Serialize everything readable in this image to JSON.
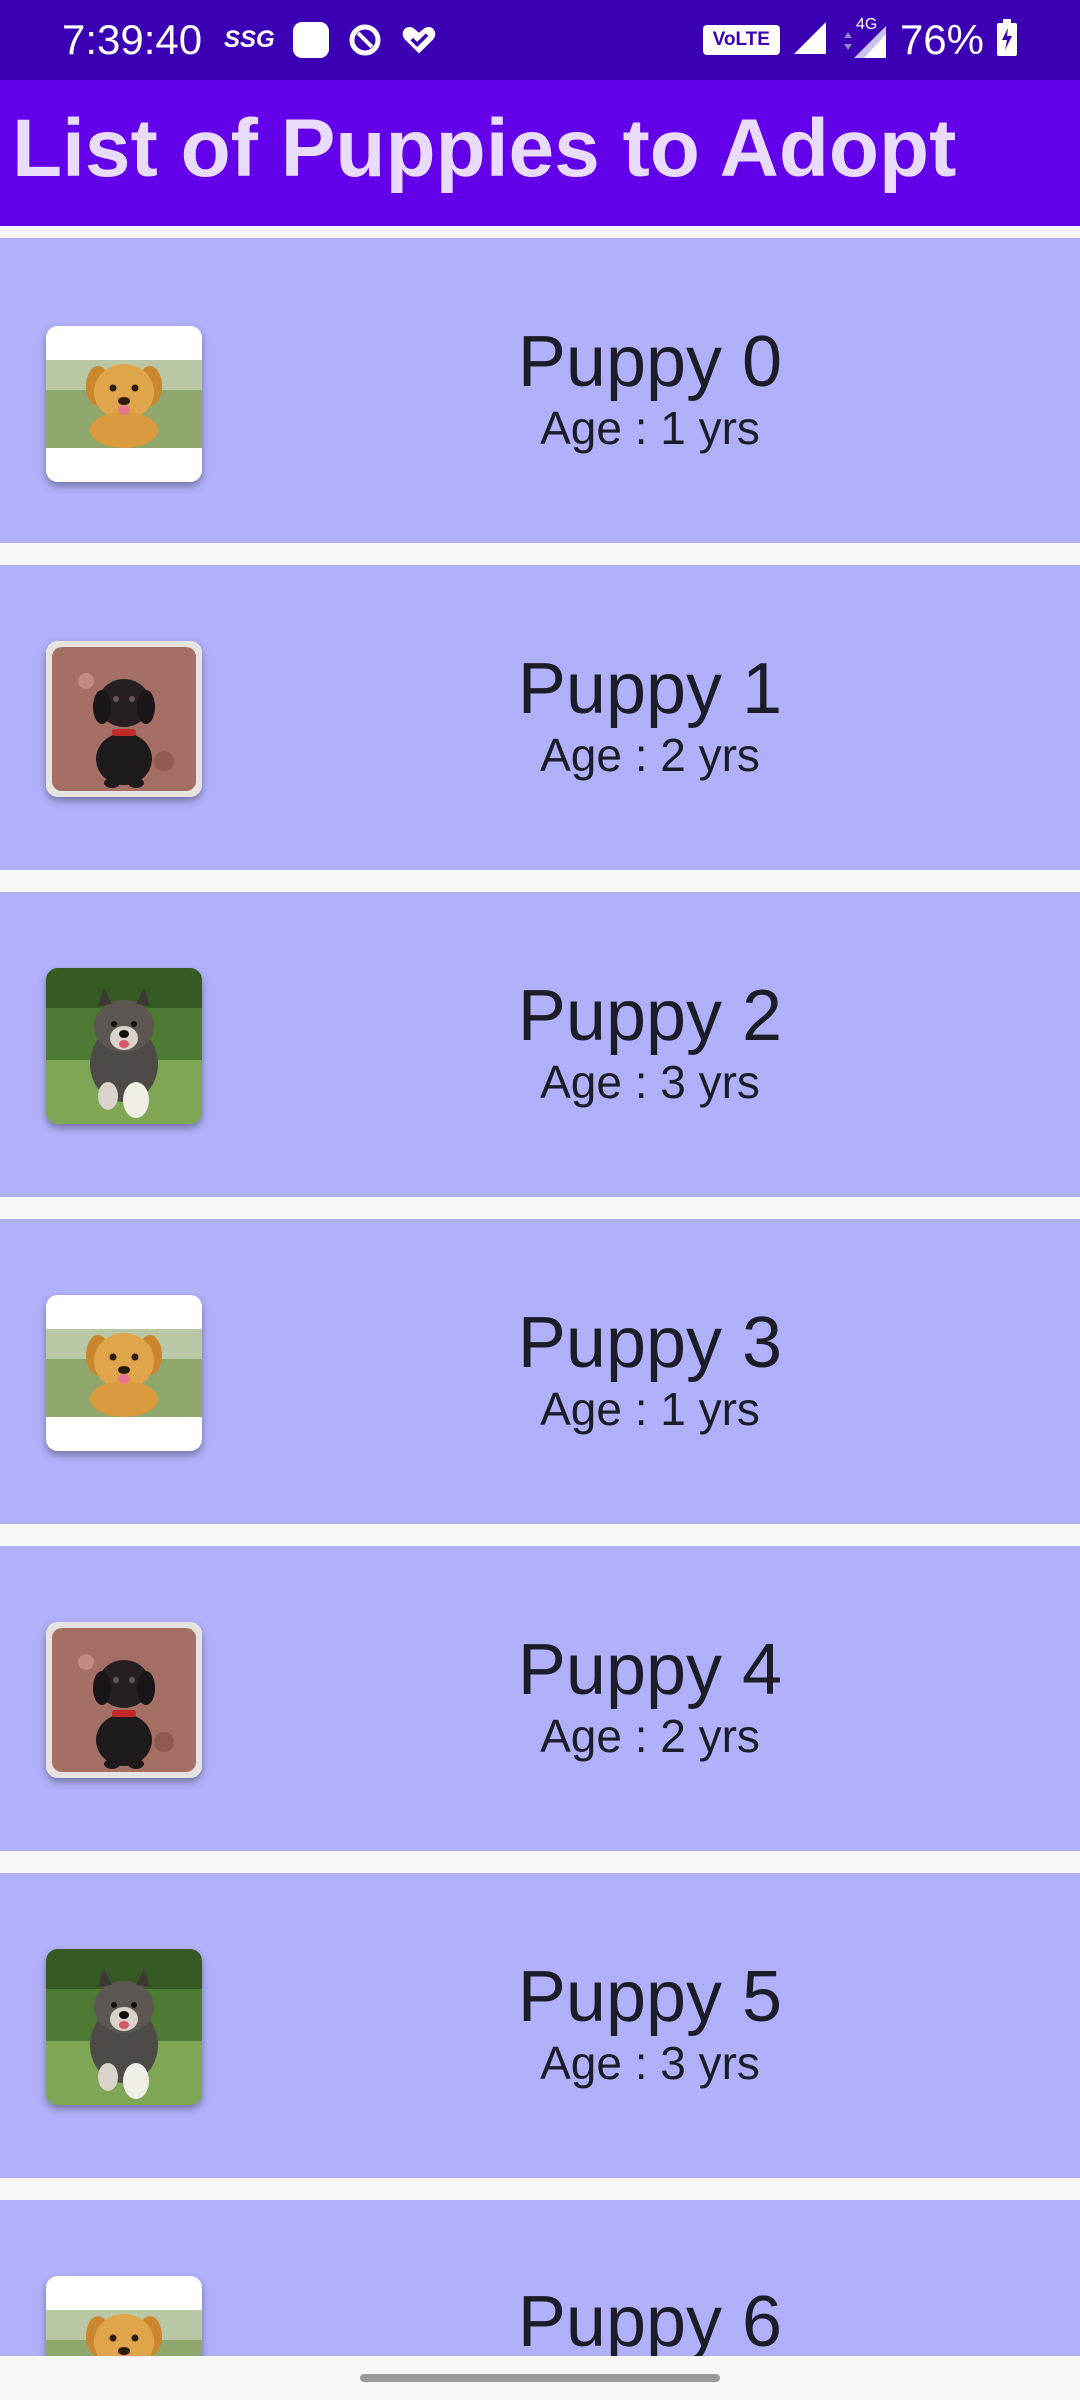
{
  "status_bar": {
    "time": "7:39:40",
    "left_indicator_text": "SSG",
    "network_badge": "VoLTE",
    "network_type": "4G",
    "battery_percent": "76%",
    "icons": [
      "app-square-icon",
      "data-saver-icon",
      "heart-check-icon",
      "signal-icon",
      "signal-4g-icon",
      "battery-icon"
    ]
  },
  "app_bar": {
    "title": "List of Puppies to Adopt",
    "color": "#6200ea"
  },
  "colors": {
    "status_bar": "#3b00b4",
    "card_background": "#b1b1fb",
    "title_text": "#e9dbfb"
  },
  "puppies": [
    {
      "name": "Puppy 0",
      "age": "Age : 1 yrs",
      "image": "golden-retriever-puppy"
    },
    {
      "name": "Puppy 1",
      "age": "Age : 2 yrs",
      "image": "black-labrador-puppy"
    },
    {
      "name": "Puppy 2",
      "age": "Age : 3 yrs",
      "image": "fluffy-running-puppy"
    },
    {
      "name": "Puppy 3",
      "age": "Age : 1 yrs",
      "image": "golden-retriever-puppy"
    },
    {
      "name": "Puppy 4",
      "age": "Age : 2 yrs",
      "image": "black-labrador-puppy"
    },
    {
      "name": "Puppy 5",
      "age": "Age : 3 yrs",
      "image": "fluffy-running-puppy"
    },
    {
      "name": "Puppy 6",
      "age": "",
      "image": "golden-retriever-puppy"
    }
  ]
}
